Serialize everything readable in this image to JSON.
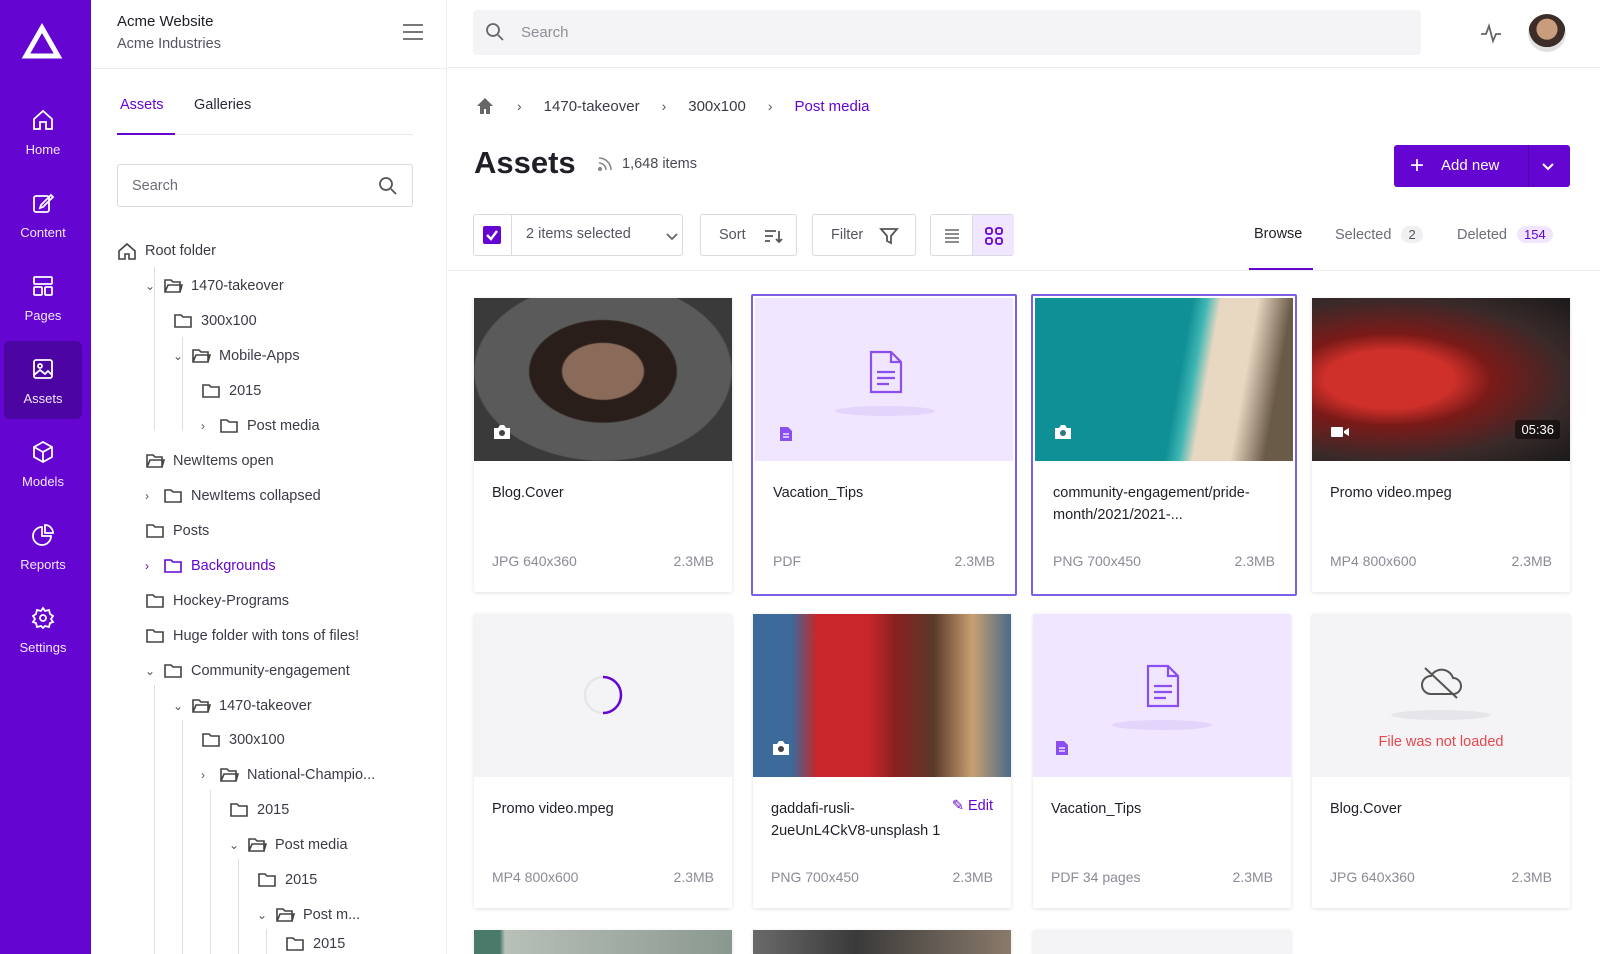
{
  "nav": [
    {
      "label": "Home",
      "icon": "home-icon"
    },
    {
      "label": "Content",
      "icon": "edit-icon"
    },
    {
      "label": "Pages",
      "icon": "pages-icon"
    },
    {
      "label": "Assets",
      "icon": "image-icon",
      "active": true
    },
    {
      "label": "Models",
      "icon": "cube-icon"
    },
    {
      "label": "Reports",
      "icon": "pie-chart-icon"
    },
    {
      "label": "Settings",
      "icon": "gear-icon"
    }
  ],
  "project": {
    "title": "Acme Website",
    "subtitle": "Acme Industries"
  },
  "panel_tabs": [
    "Assets",
    "Galleries"
  ],
  "panel_search_placeholder": "Search",
  "tree": [
    "Root folder",
    "1470-takeover",
    "300x100",
    "Mobile-Apps",
    "2015",
    "Post media",
    "NewItems open",
    "NewItems collapsed",
    "Posts",
    "Backgrounds",
    "Hockey-Programs",
    "Huge folder with tons of files!",
    "Community-engagement",
    "1470-takeover",
    "300x100",
    "National-Champio...",
    "2015",
    "Post media",
    "2015",
    "Post m...",
    "2015"
  ],
  "global_search_placeholder": "Search",
  "breadcrumbs": [
    "1470-takeover",
    "300x100",
    "Post media"
  ],
  "page_title": "Assets",
  "item_count": "1,648 items",
  "add_button": "Add new",
  "toolbar": {
    "selection": "2 items selected",
    "sort": "Sort",
    "filter": "Filter"
  },
  "browse_tabs": [
    {
      "label": "Browse"
    },
    {
      "label": "Selected",
      "badge": "2"
    },
    {
      "label": "Deleted",
      "badge": "154"
    }
  ],
  "assets": [
    {
      "name": "Blog.Cover",
      "meta": "JPG 640x360",
      "size": "2.3MB"
    },
    {
      "name": "Vacation_Tips",
      "meta": "PDF",
      "size": "2.3MB"
    },
    {
      "name": "community-engagement/pride-month/2021/2021-...",
      "meta": "PNG 700x450",
      "size": "2.3MB"
    },
    {
      "name": "Promo video.mpeg",
      "meta": "MP4 800x600",
      "size": "2.3MB",
      "duration": "05:36"
    },
    {
      "name": "Promo video.mpeg",
      "meta": "MP4 800x600",
      "size": "2.3MB"
    },
    {
      "name": "gaddafi-rusli-2ueUnL4CkV8-unsplash 1",
      "meta": "PNG 700x450",
      "size": "2.3MB",
      "edit": "Edit"
    },
    {
      "name": "Vacation_Tips",
      "meta": "PDF 34 pages",
      "size": "2.3MB"
    },
    {
      "name": "Blog.Cover",
      "meta": "JPG 640x360",
      "size": "2.3MB",
      "error": "File was not loaded"
    }
  ],
  "colors": {
    "brand": "#6505d2",
    "error": "#e5484d"
  }
}
